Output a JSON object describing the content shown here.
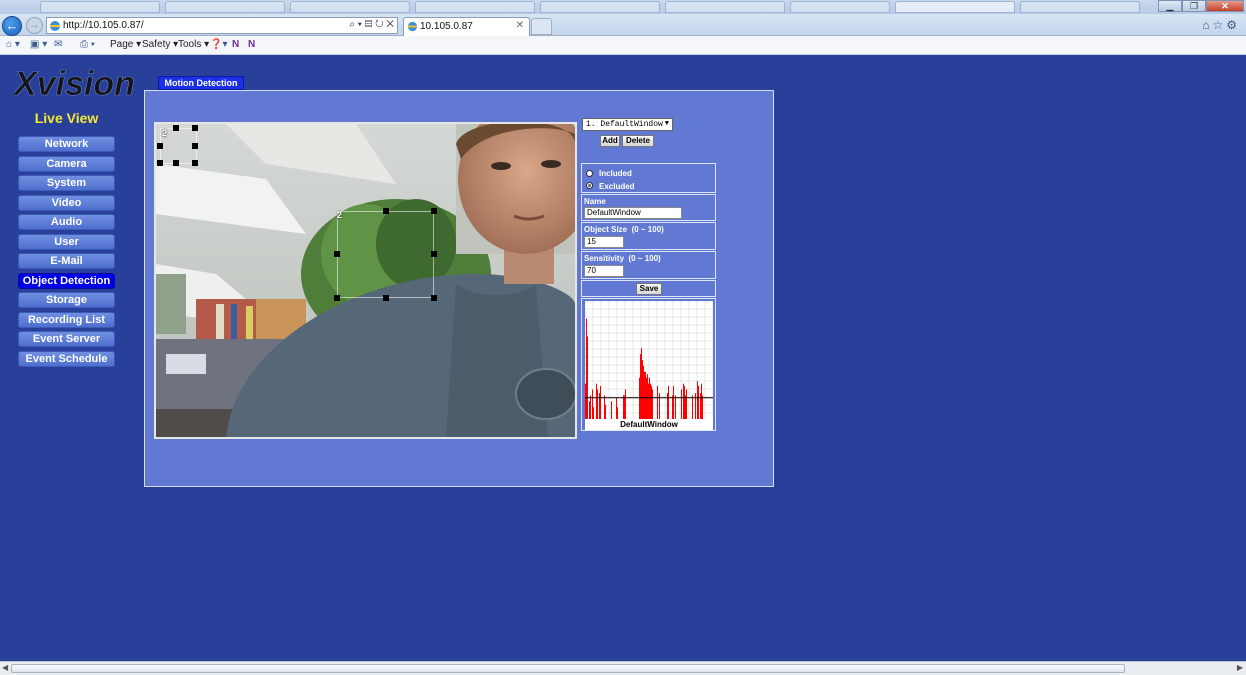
{
  "browser": {
    "url": "http://10.105.0.87/",
    "active_tab_title": "10.105.0.87",
    "commands": {
      "page": "Page ▾",
      "safety": "Safety ▾",
      "tools": "Tools ▾"
    }
  },
  "app": {
    "logo_text": "Xvision",
    "live_view": "Live View",
    "menu": [
      {
        "label": "Network"
      },
      {
        "label": "Camera"
      },
      {
        "label": "System"
      },
      {
        "label": "Video"
      },
      {
        "label": "Audio"
      },
      {
        "label": "User"
      },
      {
        "label": "E-Mail"
      },
      {
        "label": "Object Detection",
        "active": true
      },
      {
        "label": "Storage"
      },
      {
        "label": "Recording List"
      },
      {
        "label": "Event Server"
      },
      {
        "label": "Event Schedule"
      }
    ],
    "tab": "Motion Detection"
  },
  "detection": {
    "regions": [
      {
        "number": "2"
      },
      {
        "number": "2"
      }
    ],
    "window_select": "1. DefaultWindow",
    "add_label": "Add",
    "delete_label": "Delete",
    "mode": {
      "included_label": "Included",
      "excluded_label": "Excluded",
      "selected": "Excluded"
    },
    "name_label": "Name",
    "name_value": "DefaultWindow",
    "object_size_label": "Object Size",
    "object_size_range": "(0 ~ 100)",
    "object_size_value": "15",
    "sensitivity_label": "Sensitivity",
    "sensitivity_range": "(0 ~ 100)",
    "sensitivity_value": "70",
    "save_label": "Save",
    "graph_caption": "DefaultWindow",
    "graph_color": "#ff0000",
    "graph_threshold": 0.18
  }
}
